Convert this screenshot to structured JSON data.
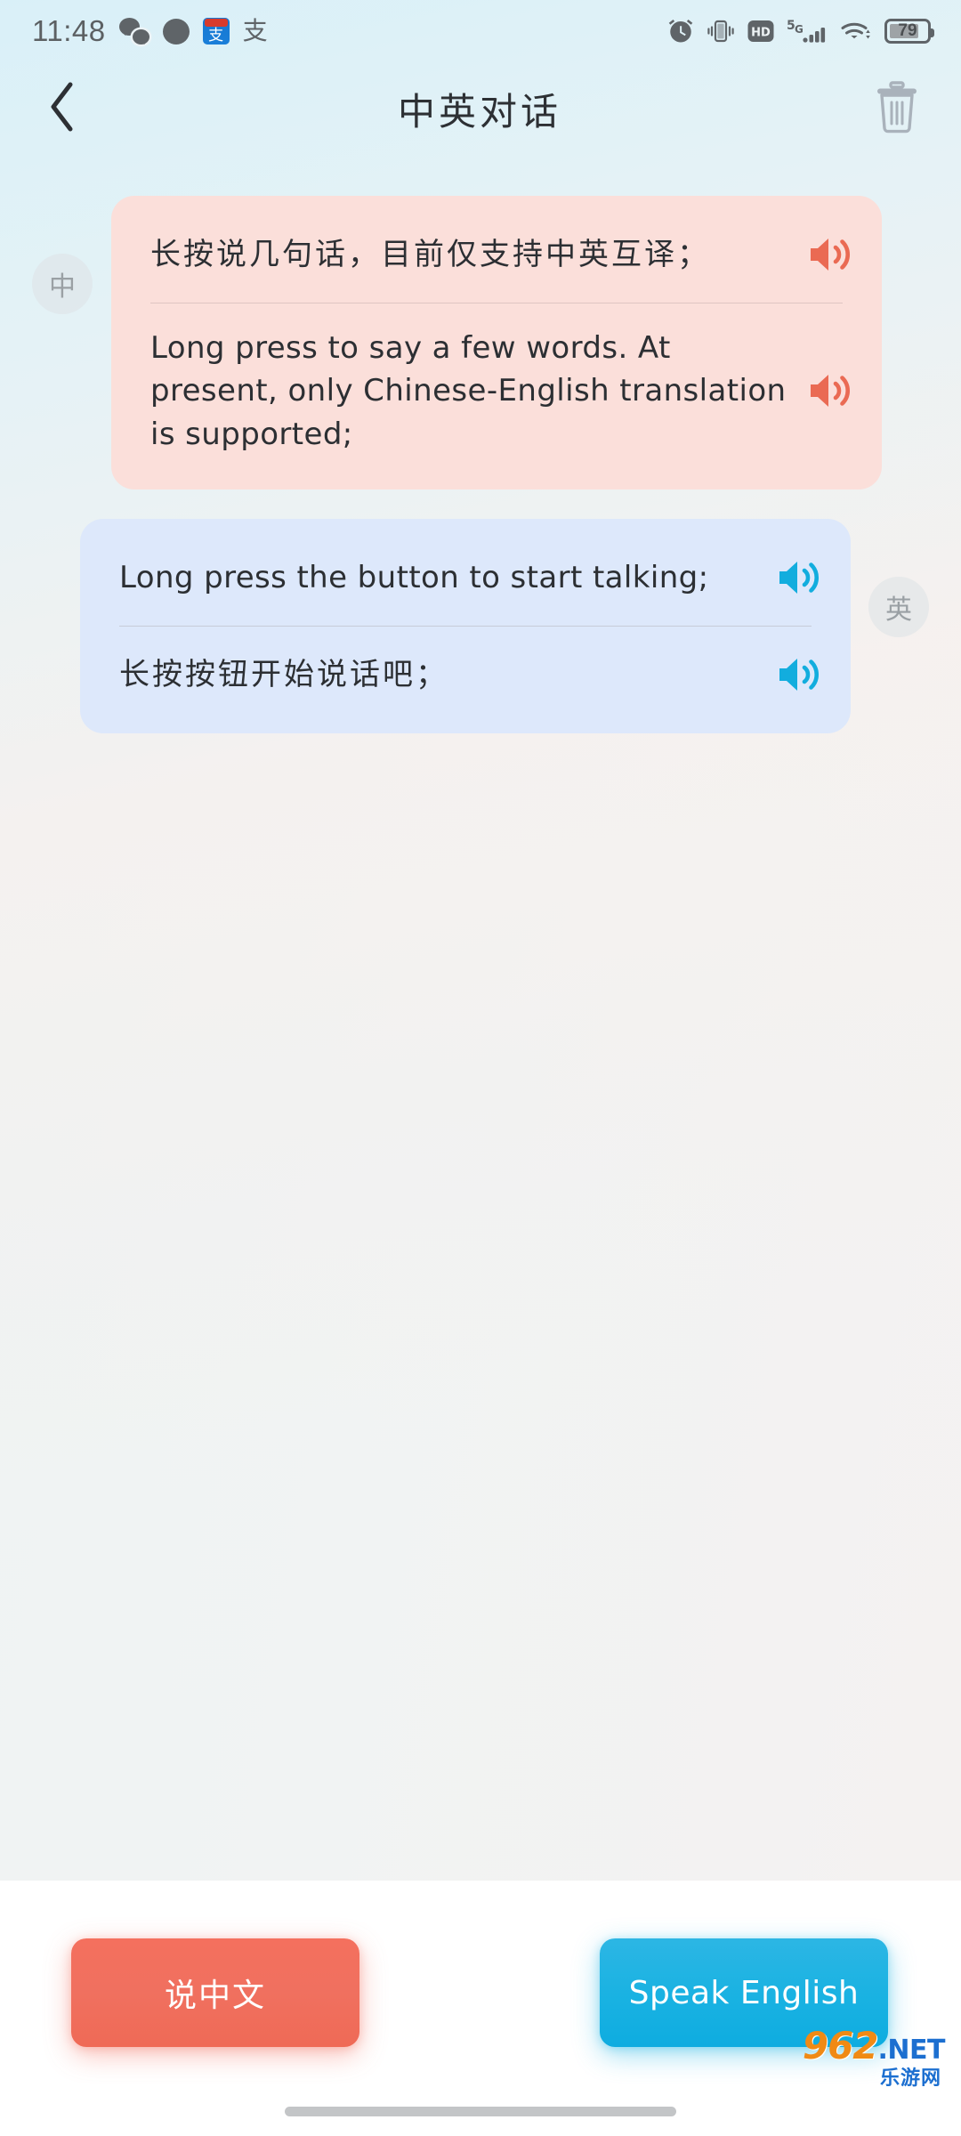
{
  "status_bar": {
    "time": "11:48",
    "battery_percent": "79",
    "battery_level": 79,
    "network": "5G",
    "hd_label": "HD",
    "left_icons": [
      "wechat-icon",
      "chat-bubble-icon",
      "alipay-icon",
      "alipay-text-icon"
    ],
    "right_icons": [
      "alarm-clock-icon",
      "vibrate-icon",
      "hd-icon",
      "5g-signal-icon",
      "wifi-icon",
      "battery-icon"
    ]
  },
  "header": {
    "title": "中英对话",
    "back_icon": "chevron-left-icon",
    "delete_icon": "trash-icon"
  },
  "conversation": {
    "messages": [
      {
        "side": "left",
        "avatar": "中",
        "bubble_color": "#fbdfda",
        "speaker_color": "#ea6a53",
        "lines": [
          {
            "text": "长按说几句话，目前仅支持中英互译；",
            "script": "han",
            "speaker_icon": "speaker-icon"
          },
          {
            "text": "Long press to say a few words. At present, only Chinese-English translation is supported;",
            "script": "latin",
            "speaker_icon": "speaker-icon"
          }
        ]
      },
      {
        "side": "right",
        "avatar": "英",
        "bubble_color": "#dde8fb",
        "speaker_color": "#12adde",
        "lines": [
          {
            "text": "Long press the button to start talking;",
            "script": "latin",
            "speaker_icon": "speaker-icon"
          },
          {
            "text": "长按按钮开始说话吧；",
            "script": "han",
            "speaker_icon": "speaker-icon"
          }
        ]
      }
    ]
  },
  "bottom_bar": {
    "speak_chinese_label": "说中文",
    "speak_english_label": "Speak English",
    "chinese_color": "#f0705f",
    "english_color": "#19b2e2"
  },
  "watermark": {
    "number": "962",
    "tld": ".NET",
    "subtitle": "乐游网"
  }
}
